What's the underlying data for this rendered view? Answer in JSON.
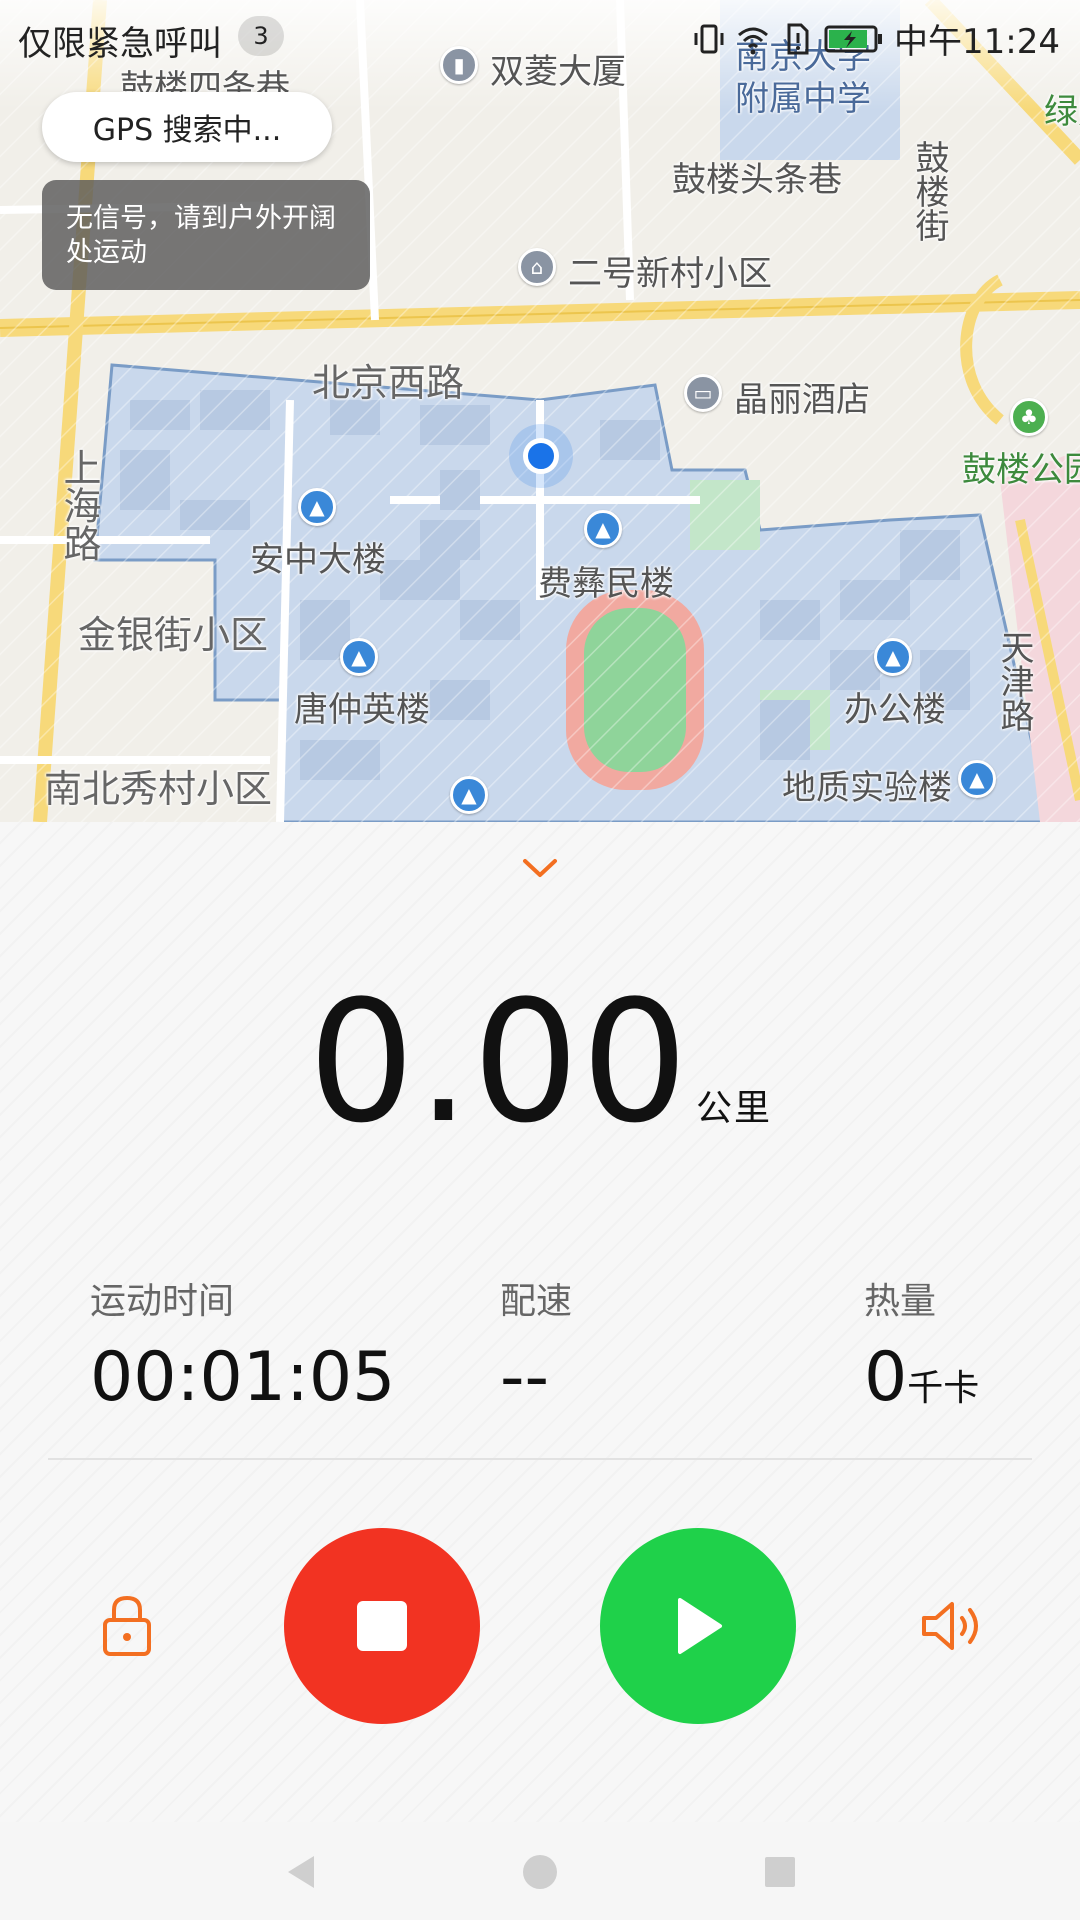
{
  "status_bar": {
    "carrier": "仅限紧急呼叫",
    "notification_count": "3",
    "time": "中午11:24",
    "icons": [
      "vibrate-icon",
      "wifi-icon",
      "sim-icon",
      "battery-charging-icon"
    ]
  },
  "gps": {
    "status": "GPS 搜索中...",
    "hint": "无信号，请到户外开阔处运动"
  },
  "map": {
    "labels": {
      "shuangling": "双菱大厦",
      "nanda_school": "南京大学\n附属中学",
      "gulou_four": "鼓楼四条巷",
      "gulou_toutiao": "鼓楼头条巷",
      "gulou_street": "鼓楼街",
      "green_shop": "绿购",
      "er_hao": "二号新村小区",
      "beijing_xilu": "北京西路",
      "jingli": "晶丽酒店",
      "gulou_park": "鼓楼公园",
      "shanghai_road": "上海路",
      "anzhong": "安中大楼",
      "feiyimin": "费彝民楼",
      "jinyin": "金银街小区",
      "tangzhongying": "唐仲英楼",
      "bangong": "办公楼",
      "tianjin_road": "天津路",
      "nanbei": "南北秀村小区",
      "dizhi": "地质实验楼"
    }
  },
  "workout": {
    "distance": "0.00",
    "distance_unit": "公里",
    "time_label": "运动时间",
    "time_value": "00:01:05",
    "pace_label": "配速",
    "pace_value": "--",
    "calories_label": "热量",
    "calories_value": "0",
    "calories_unit": "千卡"
  },
  "controls": {
    "lock": "lock-icon",
    "stop": "stop-icon",
    "resume": "play-icon",
    "sound": "speaker-icon"
  },
  "colors": {
    "accent": "#f36f21",
    "stop": "#f23322",
    "play": "#1fd14a",
    "location": "#1a73e8"
  }
}
